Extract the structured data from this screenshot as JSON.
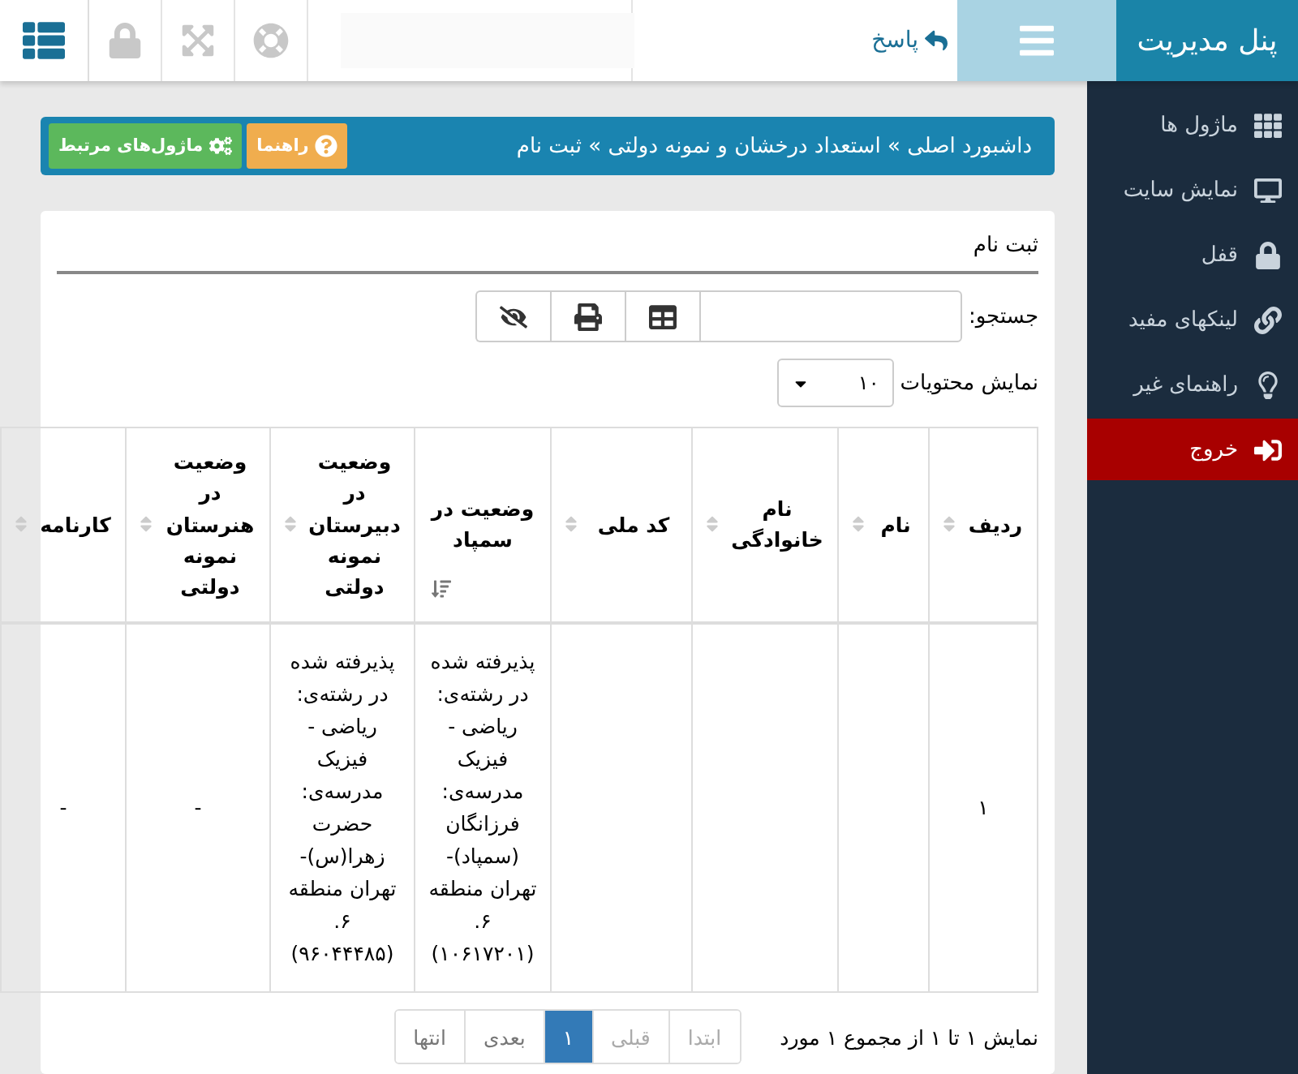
{
  "brand": {
    "title": "پنل مدیریت"
  },
  "topbar": {
    "reply_link": "پاسخ",
    "tools": [
      {
        "kind": "lock",
        "disabled": true
      },
      {
        "kind": "expand",
        "disabled": true
      },
      {
        "kind": "support",
        "disabled": true
      }
    ]
  },
  "sidebar": {
    "items": [
      {
        "label": "ماژول ها",
        "selected": false
      },
      {
        "label": "نمایش سایت",
        "selected": false
      },
      {
        "label": "قفل",
        "selected": false
      },
      {
        "label": "لینکهای مفید",
        "selected": false
      },
      {
        "label": "راهنمای غیر",
        "selected": false
      },
      {
        "label": "خروج",
        "selected": true
      }
    ]
  },
  "breadcrumb": {
    "text": "داشبورد اصلی » استعداد درخشان و نمونه دولتی » ثبت نام",
    "buttons": [
      {
        "kind": "help",
        "label": "راهنما"
      },
      {
        "kind": "modules",
        "label": "ماژول‌های مرتبط"
      }
    ]
  },
  "card": {
    "title": "ثبت نام",
    "search_label": "جستجو:",
    "page_size_label": "نمایش محتویات",
    "page_size": "۱۰"
  },
  "table": {
    "columns": [
      {
        "label": "ردیف",
        "sorted": false
      },
      {
        "label": "نام",
        "sorted": false
      },
      {
        "label": "نام خانوادگی",
        "sorted": false
      },
      {
        "label": "کد ملی",
        "sorted": false
      },
      {
        "label": "وضعیت در سمپاد",
        "sorted": true
      },
      {
        "label": "وضعیت در دبیرستان نمونه دولتی",
        "sorted": false
      },
      {
        "label": "وضعیت در هنرستان نمونه دولتی",
        "sorted": false
      },
      {
        "label": "کارنامه",
        "sorted": false
      }
    ],
    "rows": [
      {
        "cells": [
          "۱",
          "",
          "",
          "",
          "پذیرفته شده در رشته‌ی: ریاضی - فیزیک مدرسه‌ی: فرزانگان (سمپاد)- تهران منطقه ۶. (۱۰۶۱۷۲۰۱)",
          "پذیرفته شده در رشته‌ی: ریاضی - فیزیک مدرسه‌ی: حضرت زهرا(س)- تهران منطقه ۶. (۹۶۰۴۴۴۸۵)",
          "-",
          "-"
        ]
      }
    ]
  },
  "footer": {
    "info": "نمایش ۱ تا ۱ از مجموع ۱ مورد",
    "pages": [
      {
        "label": "ابتدا",
        "disabled": true,
        "selected": false
      },
      {
        "label": "قبلی",
        "disabled": true,
        "selected": false
      },
      {
        "label": "۱",
        "disabled": false,
        "selected": true
      },
      {
        "label": "بعدی",
        "disabled": false,
        "selected": false
      },
      {
        "label": "انتها",
        "disabled": false,
        "selected": false
      }
    ]
  }
}
